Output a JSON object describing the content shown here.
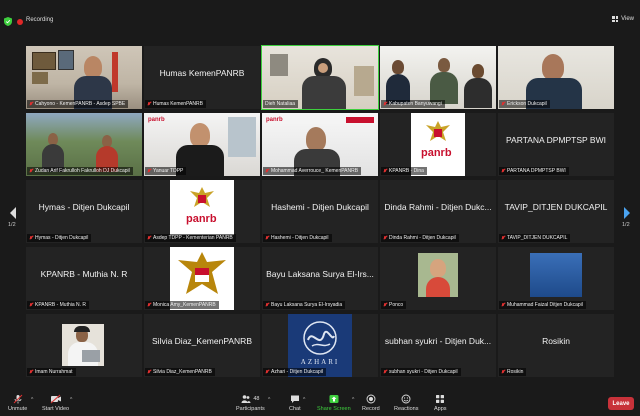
{
  "top": {
    "recording_label": "Recording",
    "view_label": "View"
  },
  "pagination": {
    "left": "1/2",
    "right": "1/2"
  },
  "tiles": [
    {
      "name": "",
      "caption": "Cahyono - KemenPANRB - Asdep SPBE"
    },
    {
      "name": "Humas KemenPANRB",
      "caption": "Humas KemenPANRB"
    },
    {
      "name": "",
      "caption": "Dieh Nataliaa"
    },
    {
      "name": "",
      "caption": "Kabupaten Banyuwangi"
    },
    {
      "name": "",
      "caption": "Erickson Dukcapil"
    },
    {
      "name": "",
      "caption": "Zudan Arif Fakrulloh Fakrulloh DJ Dukcapil"
    },
    {
      "name": "",
      "caption": "Yanuar TDPP"
    },
    {
      "name": "",
      "caption": "Mohammad Averrouce_ KemenPANRB"
    },
    {
      "name": "",
      "caption": "KPANRB - Dina"
    },
    {
      "name": "PARTANA DPMPTSP BWI",
      "caption": "PARTANA DPMPTSP BWI"
    },
    {
      "name": "Hymas - Ditjen Dukcapil",
      "caption": "Hymas - Ditjen Dukcapil"
    },
    {
      "name": "",
      "caption": "Asdep TDPP - Kementerian PANRB"
    },
    {
      "name": "Hashemi - Ditjen Dukcapil",
      "caption": "Hashemi - Ditjen Dukcapil"
    },
    {
      "name": "Dinda Rahmi - Ditjen Dukc...",
      "caption": "Dinda Rahmi - Ditjen Dukcapil"
    },
    {
      "name": "TAVIP_DITJEN DUKCAPIL",
      "caption": "TAVIP_DITJEN DUKCAPIL"
    },
    {
      "name": "KPANRB - Muthia N. R",
      "caption": "KPANRB - Muthia N. R"
    },
    {
      "name": "",
      "caption": "Monica Amy_KemenPANRB"
    },
    {
      "name": "Bayu Laksana Surya El-Irs...",
      "caption": "Bayu Laksana Surya El-Irsyadia"
    },
    {
      "name": "",
      "caption": "Ponco"
    },
    {
      "name": "",
      "caption": "Muhammad Faizal Ditjen Dukcapil"
    },
    {
      "name": "",
      "caption": "Imam Nurrahmat"
    },
    {
      "name": "Silvia Diaz_KemenPANRB",
      "caption": "Silvia Diaz_KemenPANRB"
    },
    {
      "name": "",
      "caption": "Azhari - Ditjen Dukcapil"
    },
    {
      "name": "subhan syukri - Ditjen Duk...",
      "caption": "subhan syukri - Ditjen Dukcapil"
    },
    {
      "name": "Rosikin",
      "caption": "Rosikin"
    }
  ],
  "logos": {
    "panrb": "panrb",
    "azhari": "AZHARI"
  },
  "toolbar": {
    "unmute": "Unmute",
    "start_video": "Start Video",
    "participants": "Participants",
    "participants_count": "48",
    "chat": "Chat",
    "share_screen": "Share Screen",
    "record": "Record",
    "reactions": "Reactions",
    "apps": "Apps",
    "leave": "Leave"
  },
  "colors": {
    "accent_green": "#3ecf3e",
    "leave_red": "#c8323a",
    "panrb_red": "#c8102e"
  }
}
